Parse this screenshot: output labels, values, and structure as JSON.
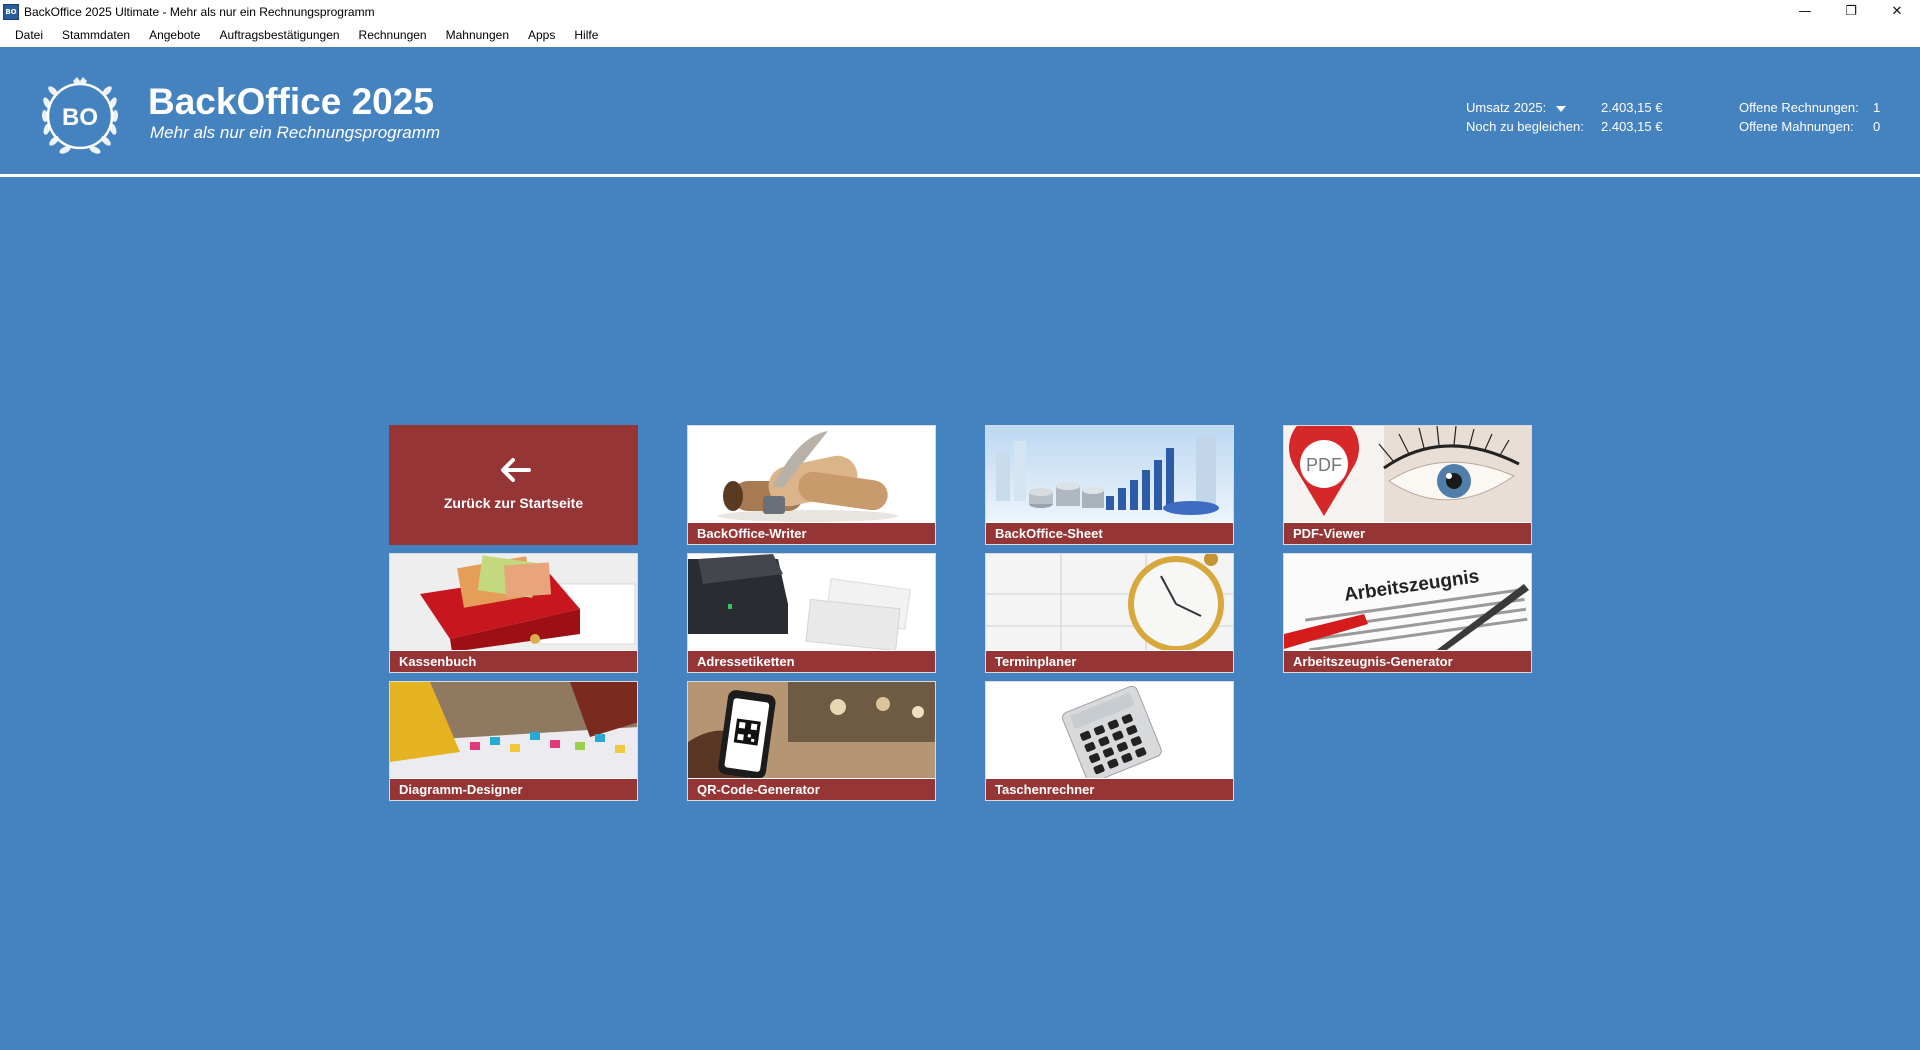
{
  "window": {
    "title": "BackOffice 2025 Ultimate - Mehr als nur ein Rechnungsprogramm",
    "icon_text": "BO",
    "controls": {
      "minimize": "—",
      "restore": "❐",
      "close": "✕"
    }
  },
  "menu": [
    "Datei",
    "Stammdaten",
    "Angebote",
    "Auftragsbestätigungen",
    "Rechnungen",
    "Mahnungen",
    "Apps",
    "Hilfe"
  ],
  "header": {
    "logo_text": "BO",
    "title": "BackOffice 2025",
    "subtitle": "Mehr als nur ein Rechnungsprogramm",
    "umsatz_label": "Umsatz 2025:",
    "umsatz_value": "2.403,15 €",
    "ausgleich_label": "Noch zu begleichen:",
    "ausgleich_value": "2.403,15 €",
    "offene_rechnungen_label": "Offene Rechnungen:",
    "offene_rechnungen_value": "1",
    "offene_mahnungen_label": "Offene Mahnungen:",
    "offene_mahnungen_value": "0"
  },
  "tiles": {
    "back": "Zurück zur Startseite",
    "writer": "BackOffice-Writer",
    "sheet": "BackOffice-Sheet",
    "pdf": "PDF-Viewer",
    "pdf_badge": "PDF",
    "kassenbuch": "Kassenbuch",
    "adressetiketten": "Adressetiketten",
    "terminplaner": "Terminplaner",
    "arbeitszeugnis": "Arbeitszeugnis-Generator",
    "arbeitszeugnis_heading": "Arbeitszeugnis",
    "diagramm": "Diagramm-Designer",
    "qrcode": "QR-Code-Generator",
    "taschenrechner": "Taschenrechner"
  },
  "colors": {
    "background": "#4582c0",
    "tile_label": "#963535",
    "back_tile": "#963535"
  }
}
